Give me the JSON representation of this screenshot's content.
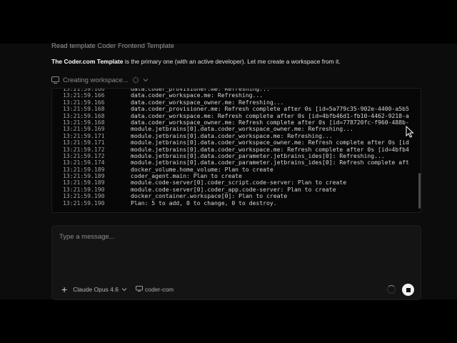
{
  "chat": {
    "read_line": "Read template Coder Frontend Template",
    "message_bold": "The Coder.com Template",
    "message_rest": " is the primary one (with an active developer). Let me create a workspace from it.",
    "tool_label": "Creating workspace..."
  },
  "log": {
    "lines": [
      {
        "ts": "13:21:59.166",
        "text": "data.coder_provisioner.me: Refreshing..."
      },
      {
        "ts": "13:21:59.166",
        "text": "data.coder_workspace.me: Refreshing..."
      },
      {
        "ts": "13:21:59.166",
        "text": "data.coder_workspace_owner.me: Refreshing..."
      },
      {
        "ts": "13:21:59.168",
        "text": "data.coder_provisioner.me: Refresh complete after 0s [id=5a779c35-902e-4400-a5b5"
      },
      {
        "ts": "13:21:59.168",
        "text": "data.coder_workspace.me: Refresh complete after 0s [id=4bfb46d1-fb10-4462-9218-a"
      },
      {
        "ts": "13:21:59.168",
        "text": "data.coder_workspace_owner.me: Refresh complete after 0s [id=778720fc-f960-488b-"
      },
      {
        "ts": "13:21:59.169",
        "text": "module.jetbrains[0].data.coder_workspace_owner.me: Refreshing..."
      },
      {
        "ts": "13:21:59.171",
        "text": "module.jetbrains[0].data.coder_workspace.me: Refreshing..."
      },
      {
        "ts": "13:21:59.171",
        "text": "module.jetbrains[0].data.coder_workspace_owner.me: Refresh complete after 0s [id"
      },
      {
        "ts": "13:21:59.172",
        "text": "module.jetbrains[0].data.coder_workspace.me: Refresh complete after 0s [id=4bfb4"
      },
      {
        "ts": "13:21:59.172",
        "text": "module.jetbrains[0].data.coder_parameter.jetbrains_ides[0]: Refreshing..."
      },
      {
        "ts": "13:21:59.174",
        "text": "module.jetbrains[0].data.coder_parameter.jetbrains_ides[0]: Refresh complete aft"
      },
      {
        "ts": "13:21:59.189",
        "text": "docker_volume.home_volume: Plan to create"
      },
      {
        "ts": "13:21:59.189",
        "text": "coder_agent.main: Plan to create"
      },
      {
        "ts": "13:21:59.189",
        "text": "module.code-server[0].coder_script.code-server: Plan to create"
      },
      {
        "ts": "13:21:59.190",
        "text": "module.code-server[0].coder_app.code-server: Plan to create"
      },
      {
        "ts": "13:21:59.190",
        "text": "docker_container.workspace[0]: Plan to create"
      },
      {
        "ts": "13:21:59.190",
        "text": "Plan: 5 to add, 0 to change, 0 to destroy."
      }
    ]
  },
  "composer": {
    "placeholder": "Type a message...",
    "model": "Claude Opus 4.6",
    "workspace": "coder-com"
  },
  "icons": [
    "monitor-icon",
    "spinner-icon",
    "chevron-down-icon",
    "plus-icon",
    "cloud-icon",
    "stop-icon",
    "mouse-cursor-icon"
  ]
}
